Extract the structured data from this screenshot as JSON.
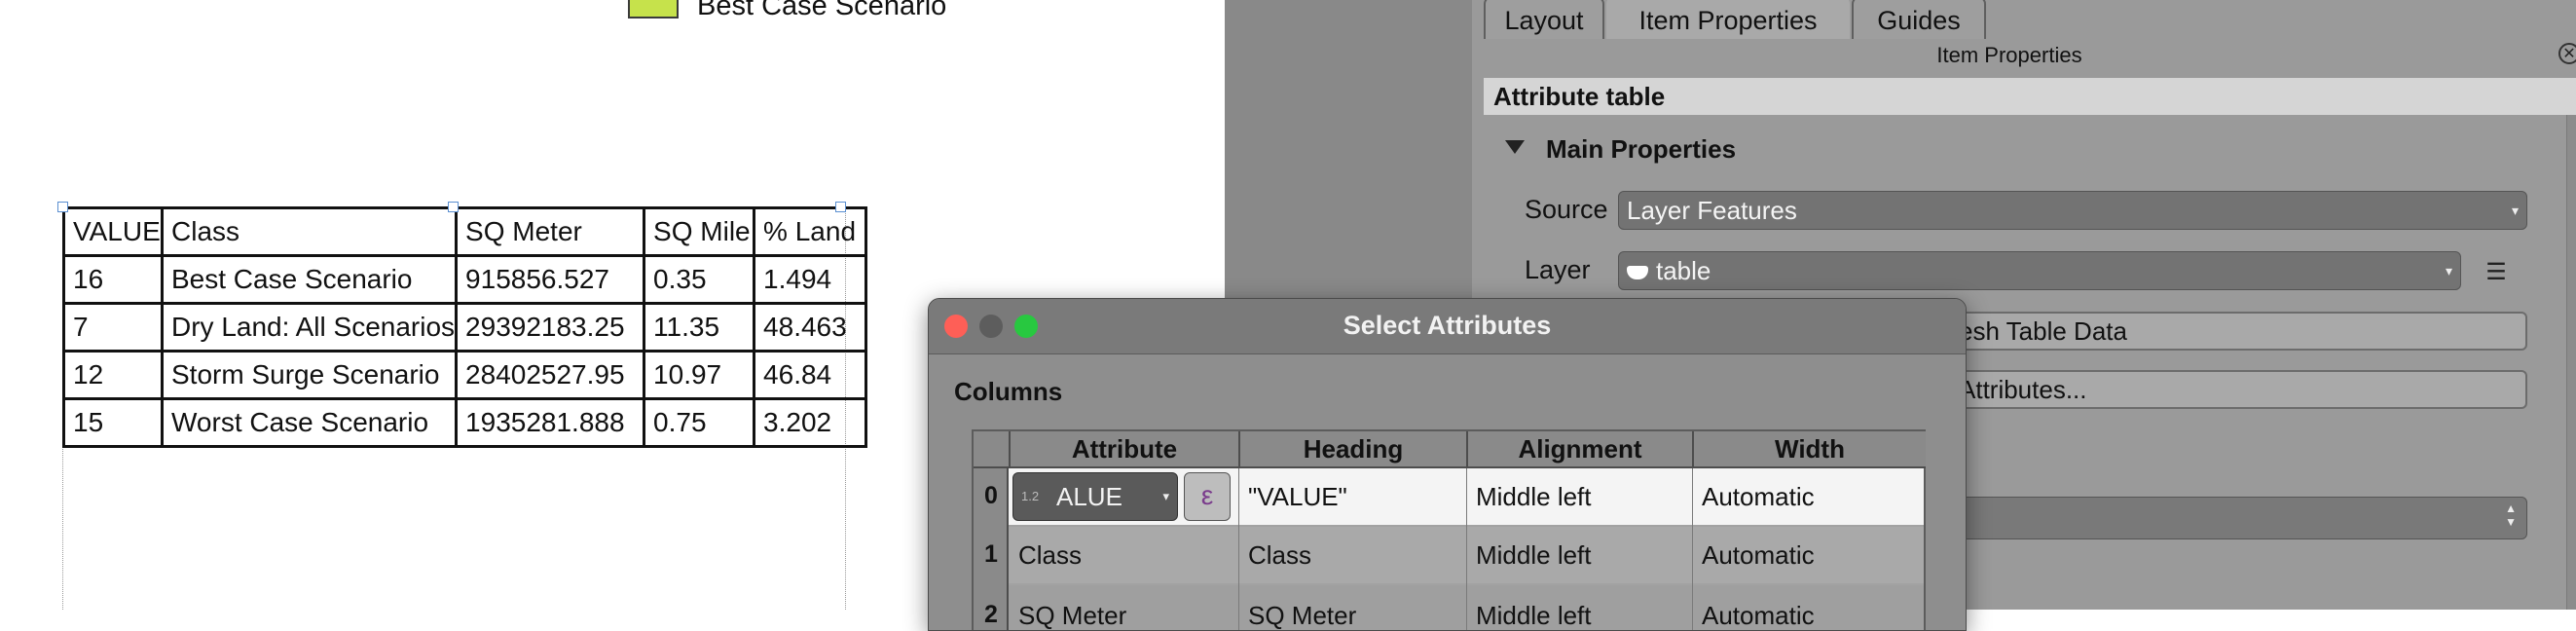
{
  "legend": {
    "label": "Best Case Scenario",
    "swatch_color": "#c6e24b"
  },
  "layout_table": {
    "headers": [
      "VALUE",
      "Class",
      "SQ Meter",
      "SQ Mile",
      "% Land"
    ],
    "rows": [
      [
        "16",
        "Best Case Scenario",
        "915856.527",
        "0.35",
        "1.494"
      ],
      [
        "7",
        "Dry Land: All Scenarios",
        "29392183.25",
        "11.35",
        "48.463"
      ],
      [
        "12",
        "Storm Surge Scenario",
        "28402527.95",
        "10.97",
        "46.84"
      ],
      [
        "15",
        "Worst Case Scenario",
        "1935281.888",
        "0.75",
        "3.202"
      ]
    ]
  },
  "panel": {
    "tabs": [
      "Layout",
      "Item Properties",
      "Guides"
    ],
    "title": "Item Properties",
    "section": "Attribute table",
    "main_properties": "Main Properties",
    "source_label": "Source",
    "source_value": "Layer Features",
    "layer_label": "Layer",
    "layer_value": "table",
    "refresh_button": "esh Table Data",
    "attributes_button": "Attributes..."
  },
  "dialog": {
    "title": "Select Attributes",
    "columns_label": "Columns",
    "headers": [
      "Attribute",
      "Heading",
      "Alignment",
      "Width"
    ],
    "rows": [
      {
        "index": "0",
        "attribute": "ALUE",
        "attribute_type_badge": "1.2",
        "heading": "\"VALUE\"",
        "alignment": "Middle left",
        "width": "Automatic"
      },
      {
        "index": "1",
        "attribute": "Class",
        "heading": "Class",
        "alignment": "Middle left",
        "width": "Automatic"
      },
      {
        "index": "2",
        "attribute": "SQ Meter",
        "heading": "SQ Meter",
        "alignment": "Middle left",
        "width": "Automatic"
      }
    ],
    "expression_symbol": "ε"
  },
  "colors": {
    "canvas": "#ffffff",
    "app_background": "#898989",
    "panel_background": "#9a9a9a",
    "close_light": "#fe5f57",
    "minimize_light": "#5d5d5d",
    "zoom_light": "#28c840"
  }
}
